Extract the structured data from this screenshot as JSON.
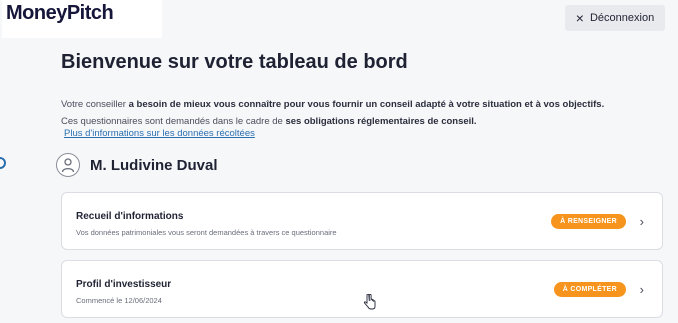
{
  "header": {
    "brand": "MoneyPitch",
    "logout_label": "Déconnexion"
  },
  "main": {
    "title": "Bienvenue sur votre tableau de bord",
    "intro_line1_a": "Votre conseiller ",
    "intro_line1_b": "a besoin de mieux vous connaître pour vous fournir un conseil adapté à votre situation et à vos objectifs.",
    "intro_line2_a": "Ces questionnaires sont demandés dans le cadre de ",
    "intro_line2_b": "ses obligations réglementaires de conseil.",
    "info_link": "Plus d'informations sur les données récoltées",
    "user_name": "M. Ludivine Duval"
  },
  "cards": [
    {
      "title": "Recueil d'informations",
      "subtitle": "Vos données patrimoniales vous seront demandées à travers ce questionnaire",
      "status": "À RENSEIGNER"
    },
    {
      "title": "Profil d'investisseur",
      "subtitle": "Commencé le 12/06/2024",
      "status": "À COMPLÉTER"
    }
  ],
  "colors": {
    "accent": "#f7941d",
    "link": "#2a6fb0",
    "background": "#f6f7f9"
  },
  "icons": {
    "avatar": "user-icon",
    "logout": "close-icon",
    "chevron": "chevron-right-icon"
  }
}
